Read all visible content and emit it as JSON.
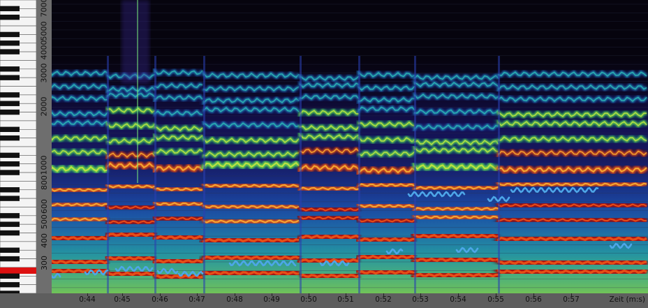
{
  "frequency_axis": {
    "labels": [
      "7000",
      "5000",
      "4000",
      "3000",
      "2000",
      "1000",
      "800",
      "600",
      "500",
      "400",
      "300"
    ]
  },
  "time_axis": {
    "labels": [
      "0:44",
      "0:45",
      "0:46",
      "0:47",
      "0:48",
      "0:49",
      "0:50",
      "0:51",
      "0:52",
      "0:53",
      "0:54",
      "0:55",
      "0:56",
      "0:57"
    ],
    "unit_label": "Zeit (m:s)"
  },
  "colors": {
    "pitch_trace": "#4da6e8",
    "playhead": "#7cf27c",
    "highlighted_key": "#dd1111",
    "background": "#06040e"
  },
  "icons": {
    "keyboard": "piano-keyboard-icon"
  }
}
